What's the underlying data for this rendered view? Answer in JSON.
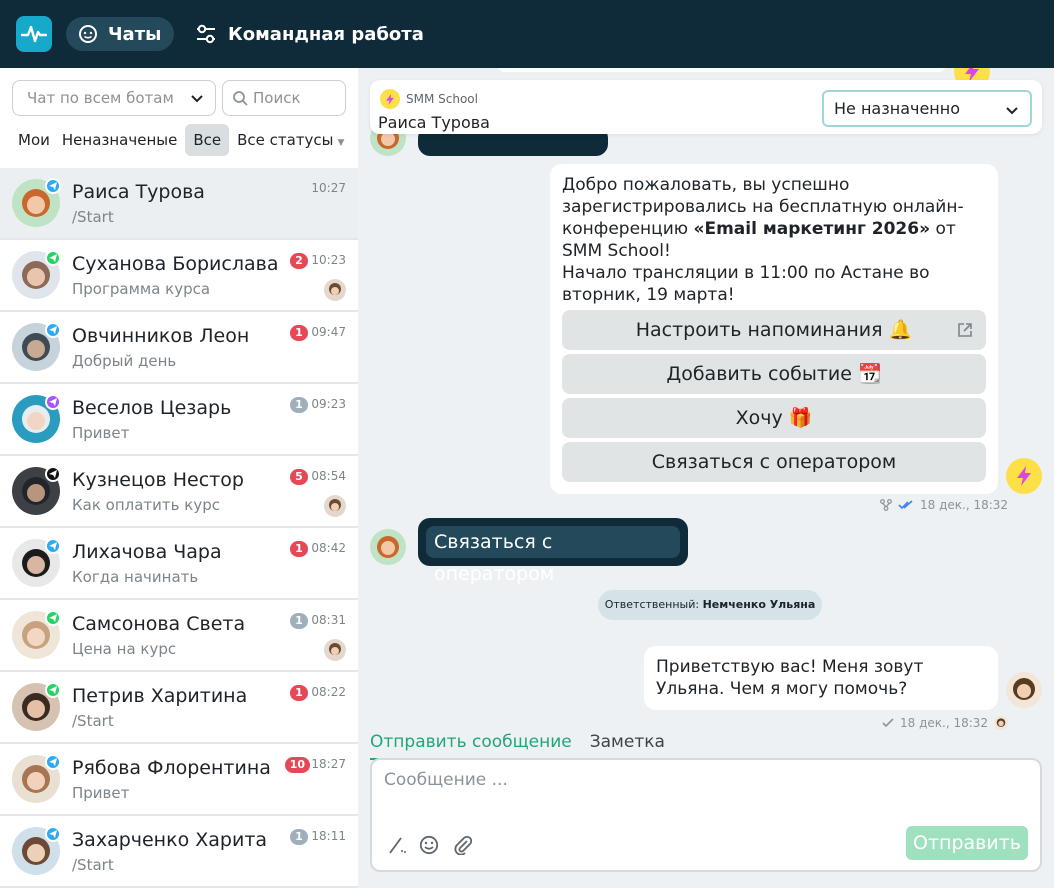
{
  "topbar": {
    "chats_label": "Чаты",
    "team_label": "Командная работа"
  },
  "sidebar": {
    "bot_select_value": "Чат по всем ботам",
    "search_placeholder": "Поиск",
    "filters": [
      "Мои",
      "Неназначеные",
      "Все",
      "Все статусы"
    ],
    "active_filter": "Все",
    "chats": [
      {
        "name": "Раиса Турова",
        "preview": "/Start",
        "time": "10:27",
        "badge": "",
        "channel": "telegram",
        "selected": true
      },
      {
        "name": "Суханова Борислава",
        "preview": "Программа курса",
        "time": "10:23",
        "badge": "2",
        "badge_color": "red",
        "channel": "whatsapp"
      },
      {
        "name": "Овчинников Леон",
        "preview": "Добрый день",
        "time": "09:47",
        "badge": "1",
        "badge_color": "red",
        "channel": "telegram"
      },
      {
        "name": "Веселов Цезарь",
        "preview": "Привет",
        "time": "09:23",
        "badge": "1",
        "badge_color": "grey",
        "channel": "messenger"
      },
      {
        "name": "Кузнецов Нестор",
        "preview": "Как оплатить курс",
        "time": "08:54",
        "badge": "5",
        "badge_color": "red",
        "channel": "tiktok"
      },
      {
        "name": "Лихачова Чара",
        "preview": "Когда начинать",
        "time": "08:42",
        "badge": "1",
        "badge_color": "red",
        "channel": "telegram"
      },
      {
        "name": "Самсонова Света",
        "preview": "Цена на курс",
        "time": "08:31",
        "badge": "1",
        "badge_color": "grey",
        "channel": "whatsapp"
      },
      {
        "name": "Петрив Харитина",
        "preview": "/Start",
        "time": "08:22",
        "badge": "1",
        "badge_color": "red",
        "channel": "whatsapp"
      },
      {
        "name": "Рябова Флорентина",
        "preview": "Привет",
        "time": "18:27",
        "badge": "10",
        "badge_color": "red",
        "channel": "telegram"
      },
      {
        "name": "Захарченко Харита",
        "preview": "/Start",
        "time": "18:11",
        "badge": "1",
        "badge_color": "grey",
        "channel": "telegram"
      }
    ]
  },
  "conversation": {
    "bot_name": "SMM School",
    "contact_name": "Раиса Турова",
    "assignee_value": "Не назначенно",
    "bot_message_part1": "Добро пожаловать, вы успешно зарегистрировались на бесплатную онлайн-конференцию ",
    "bot_message_bold": "«Email маркетинг 2026»",
    "bot_message_part2": " от SMM School!",
    "bot_message_line2": "Начало трансляции в 11:00 по Астане во вторник, 19 марта!",
    "buttons": [
      "Настроить напоминания 🔔",
      "Добавить событие 📆",
      "Хочу 🎁",
      "Связаться с оператором"
    ],
    "bot_message_time": "18 дек., 18:32",
    "user_message": "Связаться с оператором",
    "system_prefix": "Ответственный:",
    "system_operator": "Немченко Ульяна",
    "operator_message": "Приветствую вас! Меня зовут Ульяна. Чем я могу помочь?",
    "operator_message_time": "18 дек., 18:32"
  },
  "composer": {
    "tab_send": "Отправить сообщение",
    "tab_note": "Заметка",
    "placeholder": "Сообщение ...",
    "send_label": "Отправить"
  },
  "colors": {
    "topbar": "#0f2a38",
    "accent_green": "#1fa67a",
    "badge_red": "#e54856",
    "badge_grey": "#9fb0bb",
    "send_disabled": "#9fe0bf"
  }
}
